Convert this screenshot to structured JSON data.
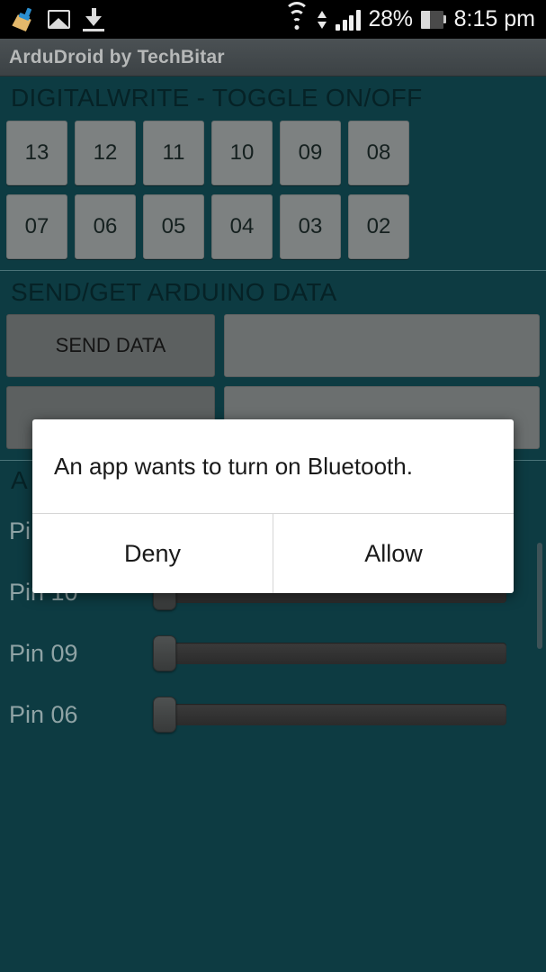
{
  "statusbar": {
    "left_icons": [
      "broom-icon",
      "image-icon",
      "download-icon"
    ],
    "wifi_icon": "wifi-icon",
    "data-transfer-icon": "up-down-arrows-icon",
    "signal_icon": "signal-bars-icon",
    "battery_percent": "28%",
    "battery_icon": "battery-icon",
    "time": "8:15 pm"
  },
  "titlebar": {
    "title": "ArduDroid by TechBitar"
  },
  "sections": {
    "digitalwrite": {
      "title": "DIGITALWRITE - TOGGLE ON/OFF",
      "row1": [
        "13",
        "12",
        "11",
        "10",
        "09",
        "08"
      ],
      "row2": [
        "07",
        "06",
        "05",
        "04",
        "03",
        "02"
      ]
    },
    "senddata": {
      "title": "SEND/GET ARDUINO DATA",
      "send_button": "SEND DATA",
      "send_field_value": "",
      "get_button": "",
      "get_field_value": ""
    },
    "analogwrite": {
      "title": "A",
      "sliders": [
        {
          "label": "Pi",
          "value": 0
        },
        {
          "label": "Pin 10",
          "value": 0
        },
        {
          "label": "Pin 09",
          "value": 0
        },
        {
          "label": "Pin 06",
          "value": 0
        }
      ]
    }
  },
  "dialog": {
    "message": "An app wants to turn on Bluetooth.",
    "deny_label": "Deny",
    "allow_label": "Allow"
  },
  "colors": {
    "background": "#0d3b42",
    "button": "#7d8181",
    "status_bar": "#000000",
    "title_bar": "#454b4e",
    "dialog_bg": "#ffffff"
  }
}
